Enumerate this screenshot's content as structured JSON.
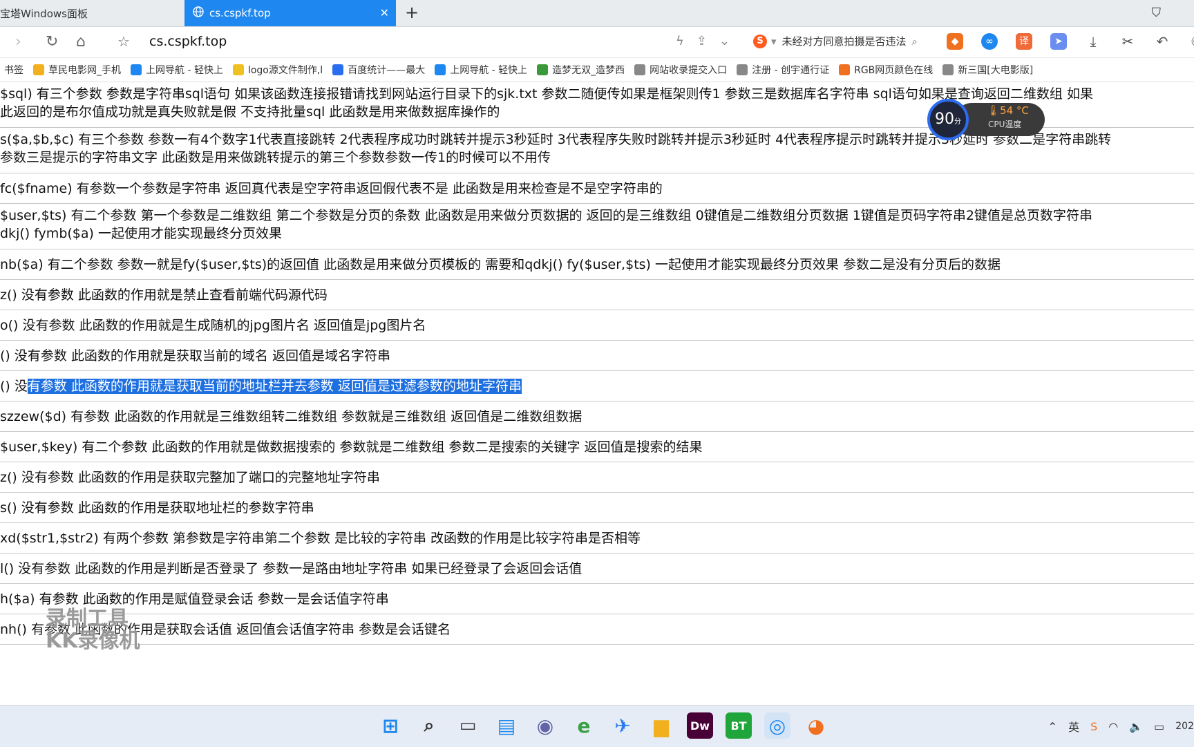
{
  "tabs": [
    {
      "label": "宝塔Windows面板"
    },
    {
      "label": "cs.cspkf.top"
    }
  ],
  "address_bar": {
    "url": "cs.cspkf.top"
  },
  "search": {
    "text": "未经对方同意拍摄是否违法"
  },
  "bookmarks": [
    {
      "label": "书签",
      "icon": "bookmark-icon",
      "color": "#888888"
    },
    {
      "label": "草民电影网_手机",
      "icon": "film-icon",
      "color": "#f2b01e"
    },
    {
      "label": "上网导航 - 轻快上",
      "icon": "ie-icon",
      "color": "#1e88f0"
    },
    {
      "label": "logo源文件制作,l",
      "icon": "gear-icon",
      "color": "#f0c020"
    },
    {
      "label": "百度统计——最大",
      "icon": "stats-icon",
      "color": "#2a6ef0"
    },
    {
      "label": "上网导航 - 轻快上",
      "icon": "ie-icon",
      "color": "#1e88f0"
    },
    {
      "label": "造梦无双_造梦西",
      "icon": "game-icon",
      "color": "#3a9a3a"
    },
    {
      "label": "网站收录提交入口",
      "icon": "globe-icon",
      "color": "#888888"
    },
    {
      "label": "注册 - 创宇通行证",
      "icon": "globe-icon",
      "color": "#888888"
    },
    {
      "label": "RGB网页颜色在线",
      "icon": "color-icon",
      "color": "#f07020"
    },
    {
      "label": "新三国[大电影版]",
      "icon": "globe-icon",
      "color": "#888888"
    }
  ],
  "rows": [
    {
      "lines": [
        "$sql)   有三个参数    参数是字符串sql语句    如果该函数连接报错请找到网站运行目录下的sjk.txt    参数二随便传如果是框架则传1    参数三是数据库名字符串    sql语句如果是查询返回二维数组    如果",
        "此返回的是布尔值成功就是真失败就是假    不支持批量sql    此函数是用来做数据库操作的"
      ]
    },
    {
      "lines": [
        "s($a,$b,$c)   有三个参数    参数一有4个数字1代表直接跳转    2代表程序成功时跳转并提示3秒延时    3代表程序失败时跳转并提示3秒延时    4代表程序提示时跳转并提示3秒延时    参数二是字符串跳转",
        "  参数三是提示的字符串文字    此函数是用来做跳转提示的第三个参数参数一传1的时候可以不用传"
      ]
    },
    {
      "lines": [
        "fc($fname)   有参数一个参数是字符串    返回真代表是空字符串返回假代表不是    此函数是用来检查是不是空字符串的"
      ]
    },
    {
      "lines": [
        "$user,$ts)   有二个参数    第一个参数是二维数组    第二个参数是分页的条数    此函数是用来做分页数据的    返回的是三维数组    0键值是二维数组分页数据    1键值是页码字符串2键值是总页数字符串",
        "dkj()    fymb($a)    一起使用才能实现最终分页效果"
      ]
    },
    {
      "lines": [
        "nb($a)   有二个参数    参数一就是fy($user,$ts)的返回值    此函数是用来做分页模板的    需要和qdkj()    fy($user,$ts)    一起使用才能实现最终分页效果    参数二是没有分页后的数据"
      ]
    },
    {
      "lines": [
        "z()   没有参数    此函数的作用就是禁止查看前端代码源代码"
      ]
    },
    {
      "lines": [
        "o()   没有参数    此函数的作用就是生成随机的jpg图片名    返回值是jpg图片名"
      ]
    },
    {
      "lines": [
        "()   没有参数    此函数的作用就是获取当前的域名    返回值是域名字符串"
      ]
    },
    {
      "lines": [
        "()   没"
      ],
      "highlight": "有参数    此函数的作用就是获取当前的地址栏并去参数    返回值是过滤参数的地址字符串"
    },
    {
      "lines": [
        "szzew($d)   有参数    此函数的作用就是三维数组转二维数组    参数就是三维数组    返回值是二维数组数据"
      ]
    },
    {
      "lines": [
        "$user,$key)   有二个参数    此函数的作用就是做数据搜索的    参数就是二维数组    参数二是搜索的关键字    返回值是搜索的结果"
      ]
    },
    {
      "lines": [
        "z()   没有参数    此函数的作用是获取完整加了端口的完整地址字符串"
      ]
    },
    {
      "lines": [
        "s()   没有参数    此函数的作用是获取地址栏的参数字符串"
      ]
    },
    {
      "lines": [
        "xd($str1,$str2)   有两个参数    第参数是字符串第二个参数    是比较的字符串    改函数的作用是比较字符串是否相等"
      ]
    },
    {
      "lines": [
        "l()   没有参数    此函数的作用是判断是否登录了    参数一是路由地址字符串    如果已经登录了会返回会话值"
      ]
    },
    {
      "lines": [
        "h($a)   有参数    此函数的作用是赋值登录会话    参数一是会话值字符串"
      ]
    },
    {
      "lines": [
        "nh()   有参数    此函数的作用是获取会话值    返回值会话值字符串    参数是会话键名"
      ]
    }
  ],
  "cpu_widget": {
    "score": "90",
    "score_unit": "分",
    "temp": "54 °C",
    "label": "CPU温度"
  },
  "watermark": {
    "line1": "录制工具",
    "line2": "KK录像机"
  },
  "taskbar": {
    "apps": [
      {
        "name": "windows-start-icon",
        "glyph": "⊞",
        "color": "#1e88f0"
      },
      {
        "name": "search-icon",
        "glyph": "⌕",
        "color": "#333333"
      },
      {
        "name": "task-view-icon",
        "glyph": "▭",
        "color": "#333333"
      },
      {
        "name": "widgets-icon",
        "glyph": "▤",
        "color": "#1e88f0"
      },
      {
        "name": "chat-icon",
        "glyph": "◉",
        "color": "#6264a7"
      },
      {
        "name": "ie-browser-icon",
        "glyph": "e",
        "color": "#3aa043"
      },
      {
        "name": "feishu-icon",
        "glyph": "✈",
        "color": "#2a7af0"
      },
      {
        "name": "file-explorer-icon",
        "glyph": "▆",
        "color": "#f2b01e"
      },
      {
        "name": "dreamweaver-icon",
        "glyph": "Dw",
        "color": "#470137"
      },
      {
        "name": "bt-panel-icon",
        "glyph": "BT",
        "color": "#20a53a"
      },
      {
        "name": "browser-icon",
        "glyph": "◎",
        "color": "#1e88f0"
      },
      {
        "name": "kk-recorder-icon",
        "glyph": "◕",
        "color": "#f07020"
      }
    ],
    "tray": {
      "ime": "英",
      "clock_partial": "202"
    }
  }
}
